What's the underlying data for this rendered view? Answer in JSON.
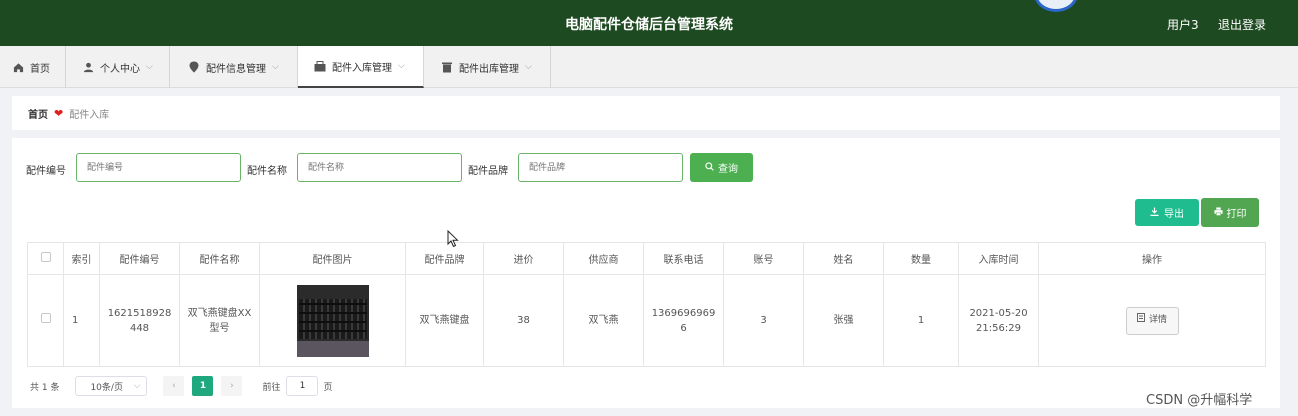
{
  "header": {
    "title": "电脑配件仓储后台管理系统",
    "user": "用户3",
    "logout": "退出登录"
  },
  "nav": [
    {
      "label": "首页",
      "icon": "home-icon",
      "has_menu": false,
      "active": false
    },
    {
      "label": "个人中心",
      "icon": "user-icon",
      "has_menu": true,
      "active": false
    },
    {
      "label": "配件信息管理",
      "icon": "pin-icon",
      "has_menu": true,
      "active": false
    },
    {
      "label": "配件入库管理",
      "icon": "box-icon",
      "has_menu": true,
      "active": true
    },
    {
      "label": "配件出库管理",
      "icon": "bin-icon",
      "has_menu": true,
      "active": false
    }
  ],
  "breadcrumb": {
    "home": "首页",
    "current": "配件入库"
  },
  "search": {
    "code_label": "配件编号",
    "code_placeholder": "配件编号",
    "name_label": "配件名称",
    "name_placeholder": "配件名称",
    "brand_label": "配件品牌",
    "brand_placeholder": "配件品牌",
    "button": "查询"
  },
  "actions": {
    "export": "导出",
    "print": "打印"
  },
  "table": {
    "columns": [
      "",
      "索引",
      "配件编号",
      "配件名称",
      "配件图片",
      "配件品牌",
      "进价",
      "供应商",
      "联系电话",
      "账号",
      "姓名",
      "数量",
      "入库时间",
      "操作"
    ],
    "rows": [
      {
        "index": "1",
        "code": "1621518928448",
        "name": "双飞燕键盘XX型号",
        "brand": "双飞燕键盘",
        "price": "38",
        "supplier": "双飞燕",
        "phone": "13696969696",
        "account": "3",
        "person": "张强",
        "quantity": "1",
        "time": "2021-05-20 21:56:29",
        "action": "详情"
      }
    ]
  },
  "pagination": {
    "total": "共 1 条",
    "page_size": "10条/页",
    "current_page": "1",
    "goto_label": "前往",
    "goto_value": "1",
    "goto_suffix": "页"
  },
  "watermark": "CSDN @升幅科学",
  "colors": {
    "header_bg": "#1e4a21",
    "accent_green": "#4caf50",
    "teal": "#1fbc8f"
  }
}
